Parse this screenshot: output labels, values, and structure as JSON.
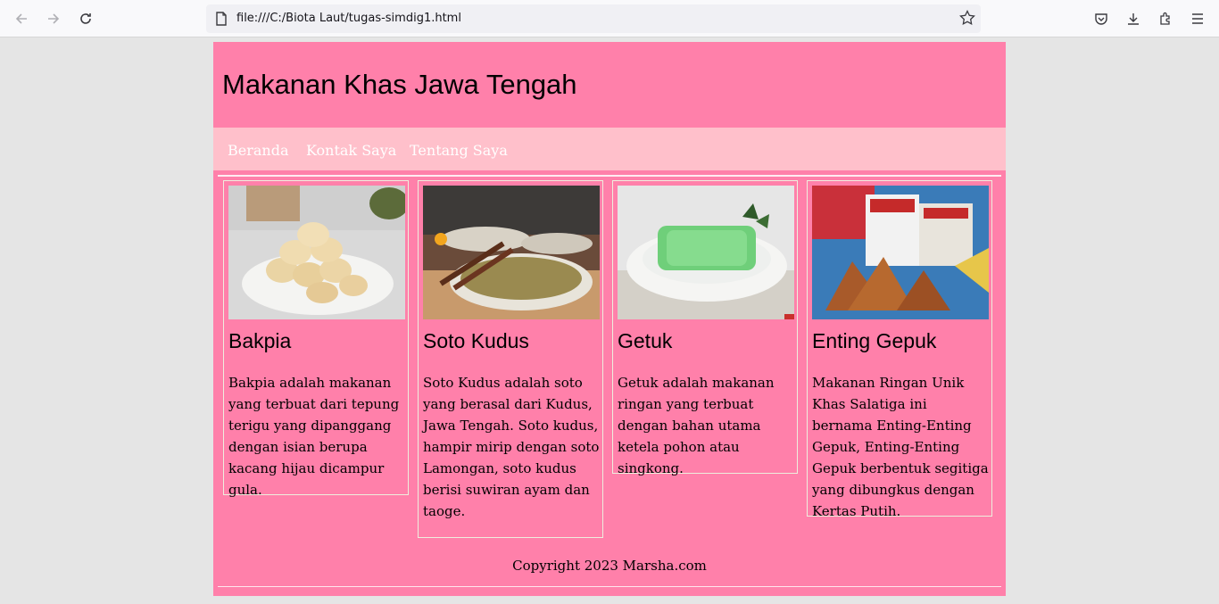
{
  "browser": {
    "url": "file:///C:/Biota Laut/tugas-simdig1.html"
  },
  "site": {
    "title": "Makanan Khas Jawa Tengah",
    "menu": [
      "Beranda",
      "Kontak Saya",
      "Tentang Saya"
    ],
    "cards": [
      {
        "title": "Bakpia",
        "text": "Bakpia adalah makanan yang terbuat dari tepung terigu yang dipanggang dengan isian berupa kacang hijau dicampur gula."
      },
      {
        "title": "Soto Kudus",
        "text": "Soto Kudus adalah soto yang berasal dari Kudus, Jawa Tengah. Soto kudus, hampir mirip dengan soto Lamongan, soto kudus berisi suwiran ayam dan taoge."
      },
      {
        "title": "Getuk",
        "text": "Getuk adalah makanan ringan yang terbuat dengan bahan utama ketela pohon atau singkong."
      },
      {
        "title": "Enting Gepuk",
        "text": "Makanan Ringan Unik Khas Salatiga ini bernama Enting-Enting Gepuk, Enting-Enting Gepuk berbentuk segitiga yang dibungkus dengan Kertas Putih."
      }
    ],
    "footer": "Copyright 2023 Marsha.com"
  },
  "colors": {
    "primary": "#ff80aa",
    "menu_bg": "#ffc0cb"
  }
}
